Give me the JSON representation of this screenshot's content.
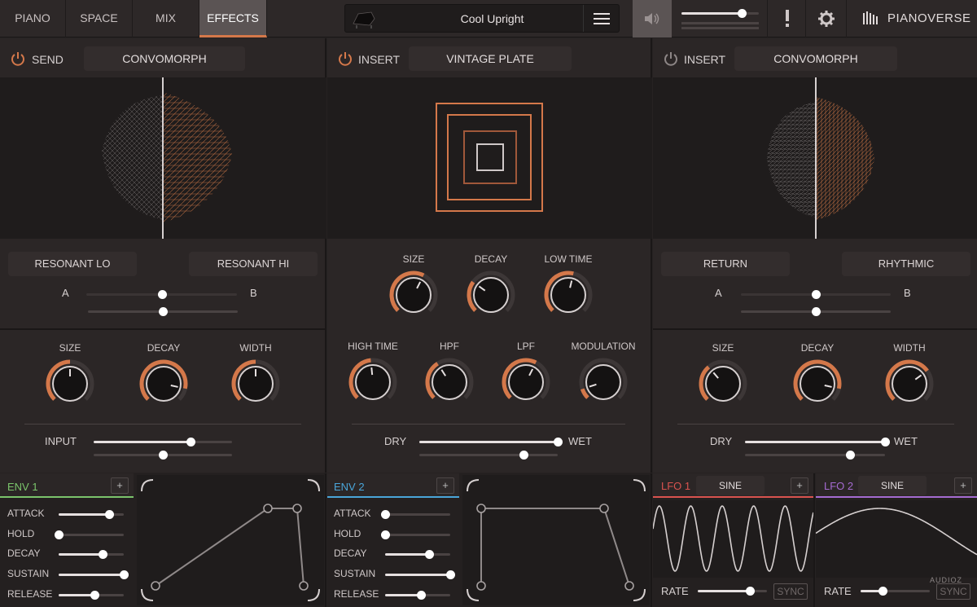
{
  "tabs": [
    {
      "label": "PIANO"
    },
    {
      "label": "SPACE"
    },
    {
      "label": "MIX"
    },
    {
      "label": "EFFECTS",
      "active": true
    }
  ],
  "preset": {
    "name": "Cool Upright"
  },
  "brand": {
    "name": "PIANOVERSE"
  },
  "volume": {
    "level": 0.78
  },
  "colors": {
    "accent": "#d4784a",
    "env1": "#7bc46b",
    "env2": "#4aa5d9",
    "lfo1": "#d9534f",
    "lfo2": "#a56bd1"
  },
  "fx": [
    {
      "slot": "SEND",
      "preset": "CONVOMORPH",
      "power_on": true,
      "morph": {
        "a_label": "RESONANT LO",
        "b_label": "RESONANT HI",
        "a_marker": "A",
        "b_marker": "B",
        "value": 0.5,
        "value2": 0.5
      },
      "knobs": [
        {
          "label": "SIZE",
          "value": 0.5
        },
        {
          "label": "DECAY",
          "value": 0.88
        },
        {
          "label": "WIDTH",
          "value": 0.5
        }
      ],
      "slider": {
        "label": "INPUT",
        "value": 0.7,
        "value2": 0.5
      }
    },
    {
      "slot": "INSERT",
      "preset": "VINTAGE PLATE",
      "power_on": true,
      "knobs_row1": [
        {
          "label": "SIZE",
          "value": 0.6
        },
        {
          "label": "DECAY",
          "value": 0.3
        },
        {
          "label": "LOW TIME",
          "value": 0.55
        }
      ],
      "knobs_row2": [
        {
          "label": "HIGH TIME",
          "value": 0.48
        },
        {
          "label": "HPF",
          "value": 0.38
        },
        {
          "label": "LPF",
          "value": 0.6
        },
        {
          "label": "MODULATION",
          "value": 0.1
        }
      ],
      "dry_label": "DRY",
      "wet_label": "WET",
      "mix": {
        "value": 1.0,
        "value2": 0.75
      }
    },
    {
      "slot": "INSERT",
      "preset": "CONVOMORPH",
      "power_on": false,
      "morph": {
        "a_label": "RETURN",
        "b_label": "RHYTHMIC",
        "a_marker": "A",
        "b_marker": "B",
        "value": 0.5,
        "value2": 0.5
      },
      "knobs": [
        {
          "label": "SIZE",
          "value": 0.35
        },
        {
          "label": "DECAY",
          "value": 0.88
        },
        {
          "label": "WIDTH",
          "value": 0.7
        }
      ],
      "dry_label": "DRY",
      "wet_label": "WET",
      "mix": {
        "value": 1.0,
        "value2": 0.75
      }
    }
  ],
  "env1": {
    "title": "ENV 1",
    "params": [
      {
        "label": "ATTACK",
        "value": 0.78
      },
      {
        "label": "HOLD",
        "value": 0.0
      },
      {
        "label": "DECAY",
        "value": 0.68
      },
      {
        "label": "SUSTAIN",
        "value": 1.0
      },
      {
        "label": "RELEASE",
        "value": 0.55
      }
    ]
  },
  "env2": {
    "title": "ENV 2",
    "params": [
      {
        "label": "ATTACK",
        "value": 0.0
      },
      {
        "label": "HOLD",
        "value": 0.0
      },
      {
        "label": "DECAY",
        "value": 0.68
      },
      {
        "label": "SUSTAIN",
        "value": 1.0
      },
      {
        "label": "RELEASE",
        "value": 0.55
      }
    ]
  },
  "lfo1": {
    "title": "LFO 1",
    "shape": "SINE",
    "rate_label": "RATE",
    "rate": 0.75,
    "sync_label": "SYNC"
  },
  "lfo2": {
    "title": "LFO 2",
    "shape": "SINE",
    "rate_label": "RATE",
    "rate": 0.32,
    "sync_label": "SYNC"
  },
  "watermark": {
    "text": "AUDIOZ"
  }
}
